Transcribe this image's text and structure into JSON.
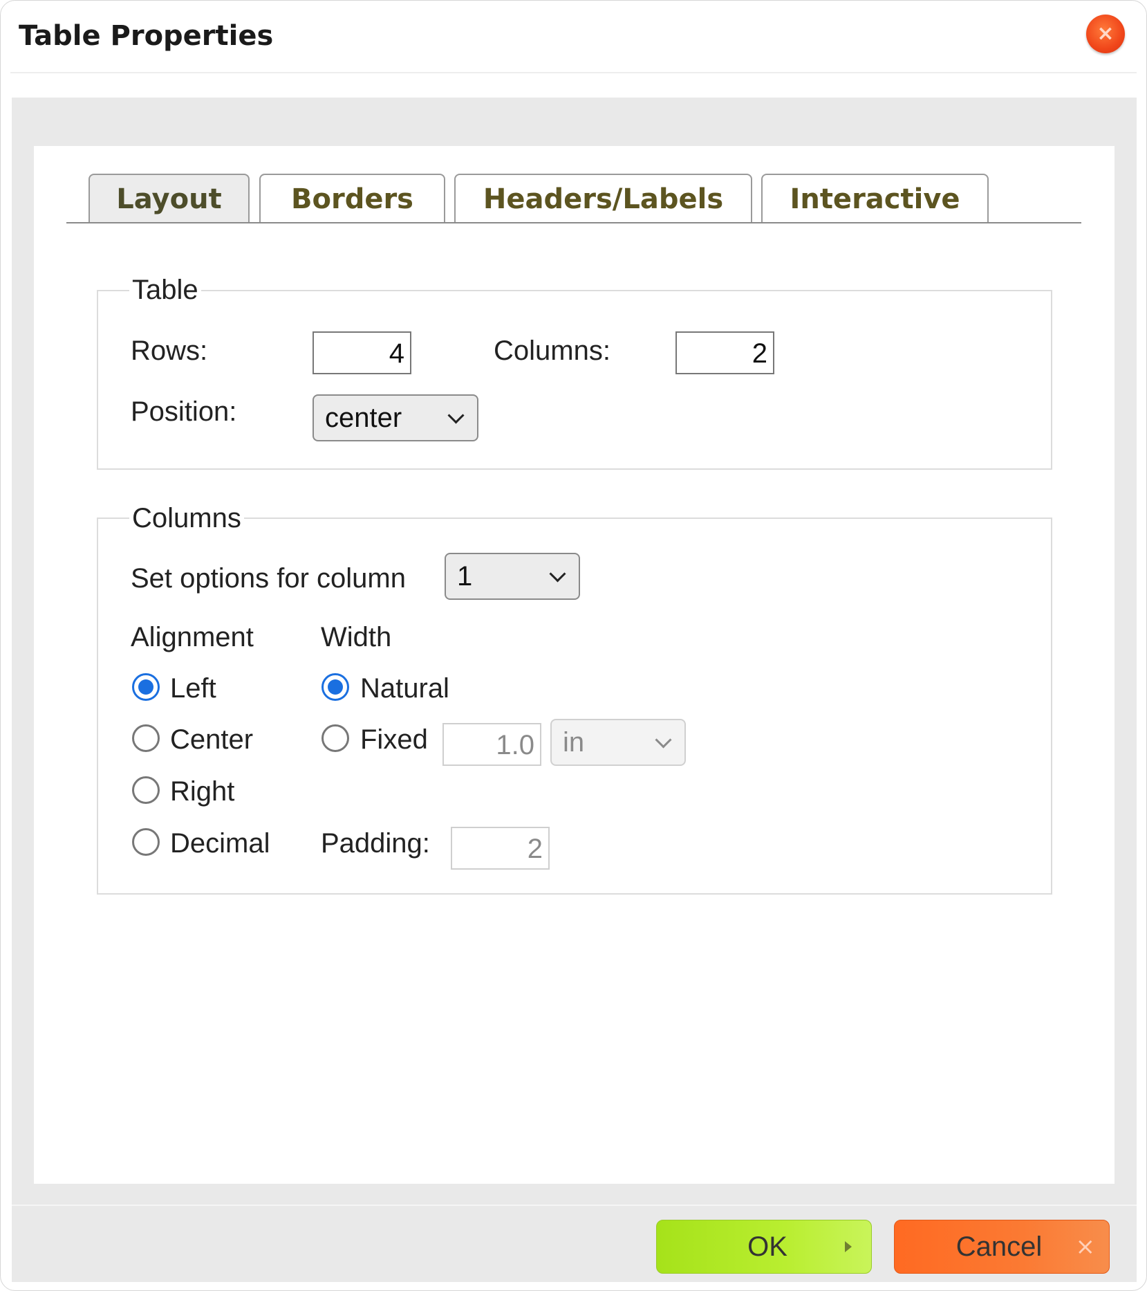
{
  "dialog": {
    "title": "Table Properties",
    "close_glyph": "×"
  },
  "tabs": [
    {
      "label": "Layout",
      "active": true
    },
    {
      "label": "Borders",
      "active": false
    },
    {
      "label": "Headers/Labels",
      "active": false
    },
    {
      "label": "Interactive",
      "active": false
    }
  ],
  "table_section": {
    "legend": "Table",
    "rows_label": "Rows:",
    "rows_value": "4",
    "columns_label": "Columns:",
    "columns_value": "2",
    "position_label": "Position:",
    "position_value": "center"
  },
  "columns_section": {
    "legend": "Columns",
    "set_options_label": "Set options for column",
    "column_value": "1",
    "alignment_header": "Alignment",
    "alignment_options": [
      {
        "label": "Left",
        "checked": true
      },
      {
        "label": "Center",
        "checked": false
      },
      {
        "label": "Right",
        "checked": false
      },
      {
        "label": "Decimal",
        "checked": false
      }
    ],
    "width_header": "Width",
    "width_options": [
      {
        "label": "Natural",
        "checked": true
      },
      {
        "label": "Fixed",
        "checked": false
      }
    ],
    "fixed_value": "1.0",
    "fixed_unit": "in",
    "padding_label": "Padding:",
    "padding_value": "2"
  },
  "footer": {
    "ok_label": "OK",
    "cancel_label": "Cancel",
    "cancel_glyph": "×"
  },
  "colors": {
    "accent": "#1a6fe0",
    "ok_button": "#b9ee30",
    "cancel_button": "#fb7a33",
    "close_button": "#f0461a",
    "tab_text": "#5c5420"
  },
  "icons": {
    "close": "close-icon",
    "ok_arrow": "play-icon",
    "cancel": "x-icon",
    "dropdown": "chevron-down-icon"
  }
}
